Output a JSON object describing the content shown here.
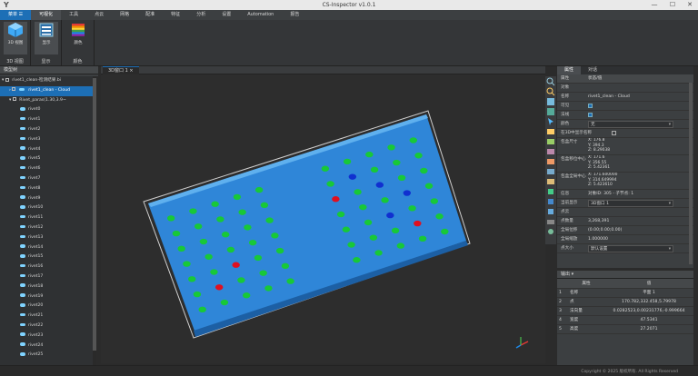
{
  "window": {
    "title": "CS-Inspector v1.0.1",
    "logo": "Y",
    "min": "—",
    "max": "☐",
    "close": "✕"
  },
  "menu": [
    "菜单",
    "可视化",
    "工具",
    "点云",
    "网格",
    "配准",
    "特征",
    "分析",
    "设置",
    "Automation",
    "报告"
  ],
  "menu_first_icon": "☰",
  "ribbon": {
    "groups": [
      {
        "label": "3D 视图",
        "button": "3D 视图"
      },
      {
        "label": "显示",
        "button": "显示"
      },
      {
        "label": "颜色",
        "button": "颜色"
      }
    ]
  },
  "tree": {
    "title": "模型树",
    "nodes": [
      {
        "label": "rivet1_clean-检测结果.bi",
        "level": 0,
        "expanded": true
      },
      {
        "label": "rivet1_clean - Cloud",
        "level": 1,
        "selected": true
      },
      {
        "label": "Rivet_paras(1.30,3.9~",
        "level": 1,
        "expanded": true
      },
      {
        "label": "rivet0"
      },
      {
        "label": "rivet1"
      },
      {
        "label": "rivet2"
      },
      {
        "label": "rivet3"
      },
      {
        "label": "rivet4"
      },
      {
        "label": "rivet5"
      },
      {
        "label": "rivet6"
      },
      {
        "label": "rivet7"
      },
      {
        "label": "rivet8"
      },
      {
        "label": "rivet9"
      },
      {
        "label": "rivet10"
      },
      {
        "label": "rivet11"
      },
      {
        "label": "rivet12"
      },
      {
        "label": "rivet13"
      },
      {
        "label": "rivet14"
      },
      {
        "label": "rivet15"
      },
      {
        "label": "rivet16"
      },
      {
        "label": "rivet17"
      },
      {
        "label": "rivet18"
      },
      {
        "label": "rivet19"
      },
      {
        "label": "rivet20"
      },
      {
        "label": "rivet21"
      },
      {
        "label": "rivet22"
      },
      {
        "label": "rivet23"
      },
      {
        "label": "rivet24"
      },
      {
        "label": "rivet25"
      }
    ]
  },
  "viewport": {
    "tab": "3D窗口 1"
  },
  "props": {
    "tabs": [
      "属性",
      "对话"
    ],
    "header": {
      "k": "属性",
      "v": "状态/值"
    },
    "section": "对象",
    "name": {
      "k": "名称",
      "v": "rivet1_clean - Cloud"
    },
    "visible": {
      "k": "可见"
    },
    "normals": {
      "k": "法线"
    },
    "color": {
      "k": "颜色",
      "v": "无"
    },
    "show_name": {
      "k": "在3D中显示名称"
    },
    "bbox_size": {
      "k": "包盒尺寸",
      "v": [
        "X: 176.8",
        "Y: 394.3",
        "Z: 8.29038"
      ]
    },
    "bbox_center": {
      "k": "包盒移位中心",
      "v": [
        "X: 171.6",
        "Y: 356.55",
        "Z: 5.42361"
      ]
    },
    "global_center": {
      "k": "包盒全局中心",
      "v": [
        "X: 171.600000",
        "Y: 314.649994",
        "Z: 5.423610"
      ]
    },
    "info": {
      "k": "信息",
      "v": "对象ID: 305 - 子节点: 1"
    },
    "current_display": {
      "k": "当前显示",
      "v": "3D窗口 1"
    },
    "cloud_section": "点云",
    "points": {
      "k": "点数量",
      "v": "3,268,391"
    },
    "global_shift": {
      "k": "全局位移",
      "v": "(0.00;0.00;0.00)"
    },
    "global_scale": {
      "k": "全局缩放",
      "v": "1.000000"
    },
    "point_size": {
      "k": "点大小",
      "v": "默认设置"
    }
  },
  "output": {
    "title": "输出",
    "columns": [
      "属性",
      "值"
    ],
    "rows": [
      {
        "i": "1",
        "k": "名称",
        "v": "平面 1"
      },
      {
        "i": "2",
        "k": "点",
        "v": "170.782,332.458,5.79978"
      },
      {
        "i": "3",
        "k": "法向量",
        "v": "0.0282523,0.00231776,-0.999664"
      },
      {
        "i": "4",
        "k": "宽度",
        "v": "47.5341"
      },
      {
        "i": "5",
        "k": "高度",
        "v": "27.2071"
      }
    ]
  },
  "status": {
    "copyright": "Copyright © 2025 版权所有. All Rights Reserved"
  }
}
